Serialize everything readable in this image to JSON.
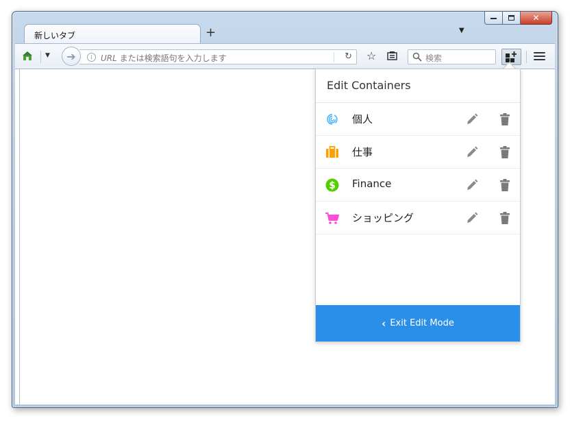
{
  "tab": {
    "title": "新しいタブ",
    "new_tab": "+"
  },
  "toolbar": {
    "url_placeholder_prefix": "URL",
    "url_placeholder_rest": " または検索語句を入力します",
    "search_placeholder": "検索"
  },
  "panel": {
    "title": "Edit Containers",
    "containers": [
      {
        "name": "個人",
        "icon": "fingerprint-icon",
        "color": "#37adff"
      },
      {
        "name": "仕事",
        "icon": "briefcase-icon",
        "color": "#ff9f00"
      },
      {
        "name": "Finance",
        "icon": "dollar-icon",
        "color": "#51cd00"
      },
      {
        "name": "ショッピング",
        "icon": "cart-icon",
        "color": "#ff4bda"
      }
    ],
    "exit_label": "Exit Edit Mode"
  },
  "colors": {
    "accent": "#2a8fe8"
  }
}
